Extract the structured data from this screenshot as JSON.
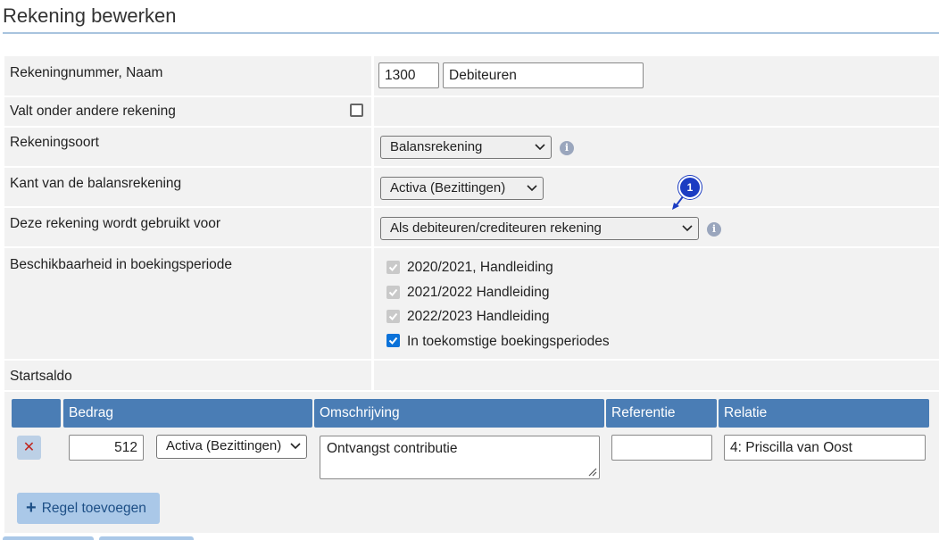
{
  "page": {
    "title": "Rekening bewerken"
  },
  "account": {
    "number_name_label": "Rekeningnummer, Naam",
    "number": "1300",
    "name": "Debiteuren",
    "parent_label": "Valt onder andere rekening",
    "parent_checked": false,
    "type_label": "Rekeningsoort",
    "type_value": "Balansrekening",
    "side_label": "Kant van de balansrekening",
    "side_value": "Activa (Bezittingen)",
    "usage_label": "Deze rekening wordt gebruikt voor",
    "usage_value": "Als debiteuren/crediteuren rekening",
    "availability_label": "Beschikbaarheid in boekingsperiode",
    "periods": [
      {
        "label": "2020/2021, Handleiding",
        "checked": true,
        "disabled": true
      },
      {
        "label": "2021/2022 Handleiding",
        "checked": true,
        "disabled": true
      },
      {
        "label": "2022/2023 Handleiding",
        "checked": true,
        "disabled": true
      },
      {
        "label": "In toekomstige boekingsperiodes",
        "checked": true,
        "disabled": false
      }
    ],
    "annotation_badge": "1",
    "info_icon": "i"
  },
  "start_balance": {
    "label": "Startsaldo",
    "columns": [
      "Bedrag",
      "Omschrijving",
      "Referentie",
      "Relatie"
    ],
    "rows": [
      {
        "amount": "512",
        "side": "Activa (Bezittingen)",
        "description": "Ontvangst contributie",
        "reference": "",
        "relation": "4: Priscilla van Oost",
        "delete_icon": "✕"
      }
    ],
    "add_row_label": "Regel toevoegen",
    "add_icon": "+"
  },
  "colors": {
    "header_blue": "#4a7db5",
    "button_blue": "#aac8e8",
    "checkbox_blue": "#0b72d9",
    "badge_blue": "#1b3cc2",
    "delete_red": "#c0261e"
  }
}
